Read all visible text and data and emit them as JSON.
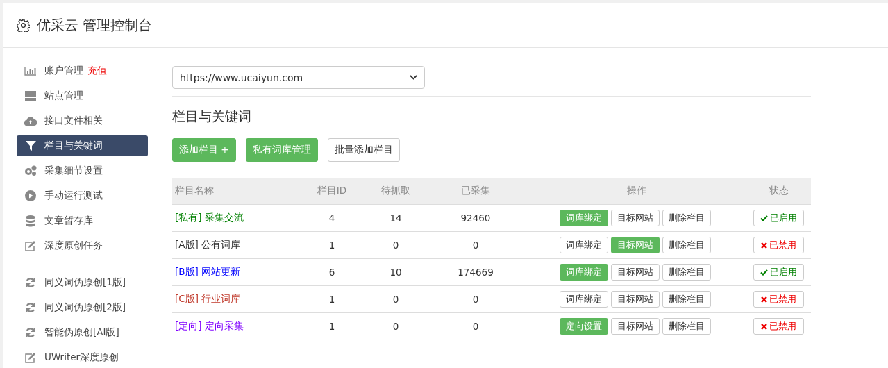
{
  "header": {
    "title": "优采云 管理控制台"
  },
  "sidebar": {
    "items": [
      {
        "label": "账户管理",
        "badge": "充值",
        "selected": false
      },
      {
        "label": "站点管理",
        "selected": false
      },
      {
        "label": "接口文件相关",
        "selected": false
      },
      {
        "label": "栏目与关键词",
        "selected": true
      },
      {
        "label": "采集细节设置",
        "selected": false
      },
      {
        "label": "手动运行测试",
        "selected": false
      },
      {
        "label": "文章暂存库",
        "selected": false
      },
      {
        "label": "深度原创任务",
        "selected": false
      },
      {
        "kind": "divider"
      },
      {
        "label": "同义词伪原创[1版]",
        "selected": false
      },
      {
        "label": "同义词伪原创[2版]",
        "selected": false
      },
      {
        "label": "智能伪原创[AI版]",
        "selected": false
      },
      {
        "label": "UWriter深度原创",
        "selected": false
      }
    ]
  },
  "site_select": {
    "value": "https://www.ucaiyun.com"
  },
  "section_title": "栏目与关键词",
  "toolbar": [
    {
      "label": "添加栏目 +",
      "primary": true
    },
    {
      "label": "私有词库管理",
      "primary": true
    },
    {
      "label": "批量添加栏目",
      "primary": false
    }
  ],
  "table": {
    "columns": [
      "栏目名称",
      "栏目ID",
      "待抓取",
      "已采集",
      "操作",
      "状态"
    ],
    "rows": [
      {
        "tag": "[私有]",
        "name": "采集交流",
        "color": "#008000",
        "id": "4",
        "pending": "14",
        "collected": "92460",
        "actions": [
          {
            "label": "词库绑定",
            "active": true
          },
          {
            "label": "目标网站",
            "active": false
          },
          {
            "label": "删除栏目",
            "active": false
          }
        ],
        "status": "已启用",
        "enabled": true
      },
      {
        "tag": "[A版]",
        "name": "公有词库",
        "color": "#333333",
        "id": "1",
        "pending": "0",
        "collected": "0",
        "actions": [
          {
            "label": "词库绑定",
            "active": false
          },
          {
            "label": "目标网站",
            "active": true
          },
          {
            "label": "删除栏目",
            "active": false
          }
        ],
        "status": "已禁用",
        "enabled": false
      },
      {
        "tag": "[B版]",
        "name": "网站更新",
        "color": "#0000ff",
        "id": "6",
        "pending": "10",
        "collected": "174669",
        "actions": [
          {
            "label": "词库绑定",
            "active": true
          },
          {
            "label": "目标网站",
            "active": false
          },
          {
            "label": "删除栏目",
            "active": false
          }
        ],
        "status": "已启用",
        "enabled": true
      },
      {
        "tag": "[C版]",
        "name": "行业词库",
        "color": "#c0392b",
        "id": "1",
        "pending": "0",
        "collected": "0",
        "actions": [
          {
            "label": "词库绑定",
            "active": false
          },
          {
            "label": "目标网站",
            "active": false
          },
          {
            "label": "删除栏目",
            "active": false
          }
        ],
        "status": "已禁用",
        "enabled": false
      },
      {
        "tag": "[定向]",
        "name": "定向采集",
        "color": "#8000ff",
        "id": "1",
        "pending": "0",
        "collected": "0",
        "actions": [
          {
            "label": "定向设置",
            "active": true
          },
          {
            "label": "目标网站",
            "active": false
          },
          {
            "label": "删除栏目",
            "active": false
          }
        ],
        "status": "已禁用",
        "enabled": false
      }
    ]
  }
}
